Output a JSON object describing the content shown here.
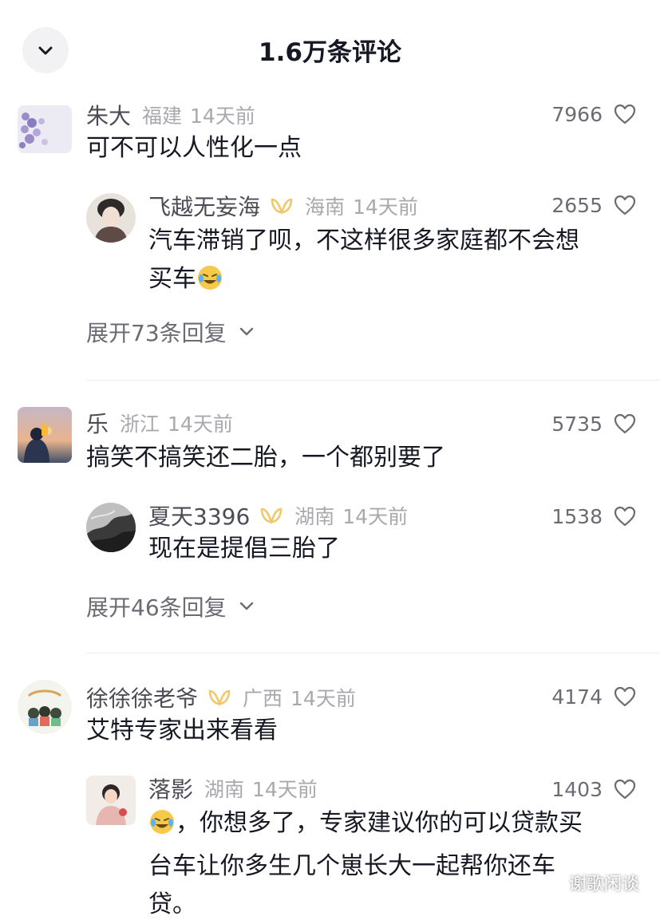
{
  "header": {
    "title": "1.6万条评论",
    "back_icon": "chevron-down-icon"
  },
  "comments": [
    {
      "name": "朱大",
      "location": "福建",
      "time": "14天前",
      "text": "可不可以人性化一点",
      "likes": "7966",
      "reply": {
        "name": "飞越无妄海",
        "location": "海南",
        "time": "14天前",
        "text_line1": "汽车滞销了呗，不这样很多家庭都不会想",
        "text_line2": "买车",
        "likes": "2655"
      },
      "expand": "展开73条回复"
    },
    {
      "name": "乐",
      "location": "浙江",
      "time": "14天前",
      "text": "搞笑不搞笑还二胎，一个都别要了",
      "likes": "5735",
      "reply": {
        "name": "夏天3396",
        "location": "湖南",
        "time": "14天前",
        "text_line1": "现在是提倡三胎了",
        "likes": "1538"
      },
      "expand": "展开46条回复"
    },
    {
      "name": "徐徐徐老爷",
      "location": "广西",
      "time": "14天前",
      "text": "艾特专家出来看看",
      "likes": "4174",
      "reply": {
        "name": "落影",
        "location": "湖南",
        "time": "14天前",
        "text_line1": "，你想多了，专家建议你的可以贷款买",
        "text_line2": "台车让你多生几个崽长大一起帮你还车",
        "text_line3": "贷。",
        "likes": "1403"
      }
    }
  ],
  "watermark": "谢歌闲谈",
  "colors": {
    "badge": "#f0c86a",
    "meta_gray": "#a8a9af",
    "name_gray": "#4b4c55"
  }
}
